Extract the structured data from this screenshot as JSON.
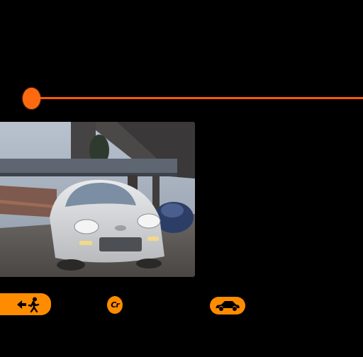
{
  "colors": {
    "background": "#000000",
    "accent": "#ff8c00",
    "timeline": "#ff5a05"
  },
  "timeline": {
    "position": 0
  },
  "preview": {
    "content": "race-replay-scene"
  },
  "buttons": {
    "exit": {
      "icon": "exit-arrow-running-person-icon"
    },
    "credits": {
      "label": "Cr"
    },
    "car": {
      "icon": "car-icon"
    }
  }
}
